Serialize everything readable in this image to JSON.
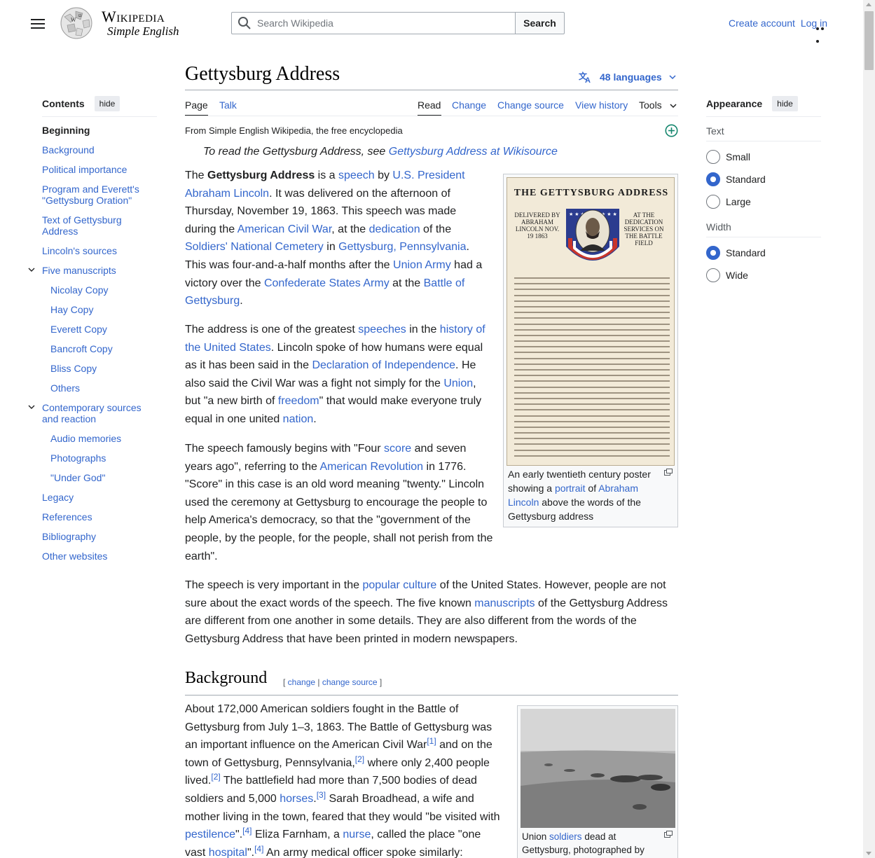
{
  "header": {
    "wordmark_title": "Wikipedia",
    "wordmark_subtitle": "Simple English",
    "search_placeholder": "Search Wikipedia",
    "search_button": "Search",
    "create_account": "Create account",
    "log_in": "Log in"
  },
  "toc": {
    "title": "Contents",
    "hide": "hide",
    "items": [
      {
        "label": "Beginning"
      },
      {
        "label": "Background"
      },
      {
        "label": "Political importance"
      },
      {
        "label": "Program and Everett's \"Gettysburg Oration\""
      },
      {
        "label": "Text of Gettysburg Address"
      },
      {
        "label": "Lincoln's sources"
      },
      {
        "label": "Five manuscripts"
      },
      {
        "label": "Nicolay Copy"
      },
      {
        "label": "Hay Copy"
      },
      {
        "label": "Everett Copy"
      },
      {
        "label": "Bancroft Copy"
      },
      {
        "label": "Bliss Copy"
      },
      {
        "label": "Others"
      },
      {
        "label": "Contemporary sources and reaction"
      },
      {
        "label": "Audio memories"
      },
      {
        "label": "Photographs"
      },
      {
        "label": "\"Under God\""
      },
      {
        "label": "Legacy"
      },
      {
        "label": "References"
      },
      {
        "label": "Bibliography"
      },
      {
        "label": "Other websites"
      }
    ]
  },
  "article": {
    "title": "Gettysburg Address",
    "languages": "48 languages",
    "tabs": {
      "page": "Page",
      "talk": "Talk",
      "read": "Read",
      "change": "Change",
      "change_source": "Change source",
      "view_history": "View history",
      "tools": "Tools"
    },
    "tagline": "From Simple English Wikipedia, the free encyclopedia",
    "hatnote_prefix": "To read the Gettysburg Address, see ",
    "hatnote_link": "Gettysburg Address at Wikisource",
    "section_background": "Background",
    "edit_change": "change",
    "edit_change_source": "change source"
  },
  "figures": {
    "poster": {
      "title": "THE GETTYSBURG ADDRESS",
      "left_text": "DELIVERED BY ABRAHAM LINCOLN NOV. 19 1863",
      "right_text": "AT THE DEDICATION SERVICES ON THE BATTLE FIELD",
      "caption_1": "An early twentieth century poster showing a ",
      "caption_link_1": "portrait",
      "caption_2": " of ",
      "caption_link_2": "Abraham Lincoln",
      "caption_3": " above the words of the Gettysburg address"
    },
    "photo": {
      "caption_1": "Union ",
      "caption_link": "soldiers",
      "caption_2": " dead at Gettysburg, photographed by"
    }
  },
  "appearance": {
    "title": "Appearance",
    "hide": "hide",
    "text_label": "Text",
    "text_options": [
      "Small",
      "Standard",
      "Large"
    ],
    "text_selected": "Standard",
    "width_label": "Width",
    "width_options": [
      "Standard",
      "Wide"
    ],
    "width_selected": "Standard"
  },
  "colors": {
    "link": "#3366cc",
    "text": "#202122",
    "border": "#a2a9b1"
  }
}
